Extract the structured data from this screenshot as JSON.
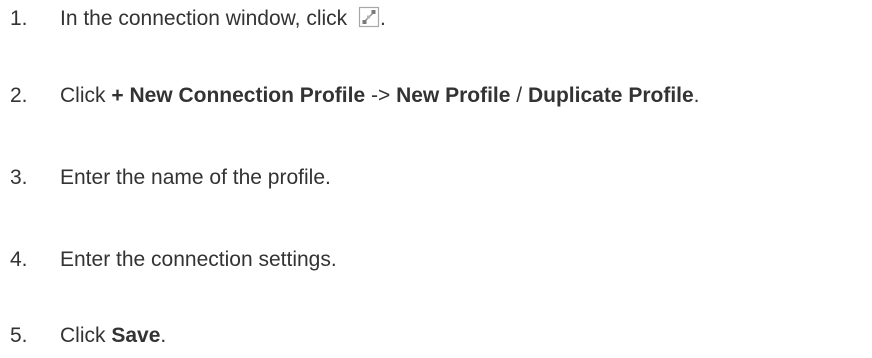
{
  "steps": [
    {
      "number": "1.",
      "text": "In the connection window, click ",
      "icon": "connection-profile-icon",
      "suffix": "."
    },
    {
      "number": "2.",
      "prefix": "Click ",
      "bold1": "+ New Connection Profile",
      "arrow": " -> ",
      "bold2": "New Profile",
      "slash": " / ",
      "bold3": "Duplicate Profile",
      "suffix": "."
    },
    {
      "number": "3.",
      "text": "Enter the name of the profile."
    },
    {
      "number": "4.",
      "text": "Enter the connection settings."
    },
    {
      "number": "5.",
      "prefix": "Click ",
      "bold": "Save",
      "suffix": "."
    }
  ]
}
